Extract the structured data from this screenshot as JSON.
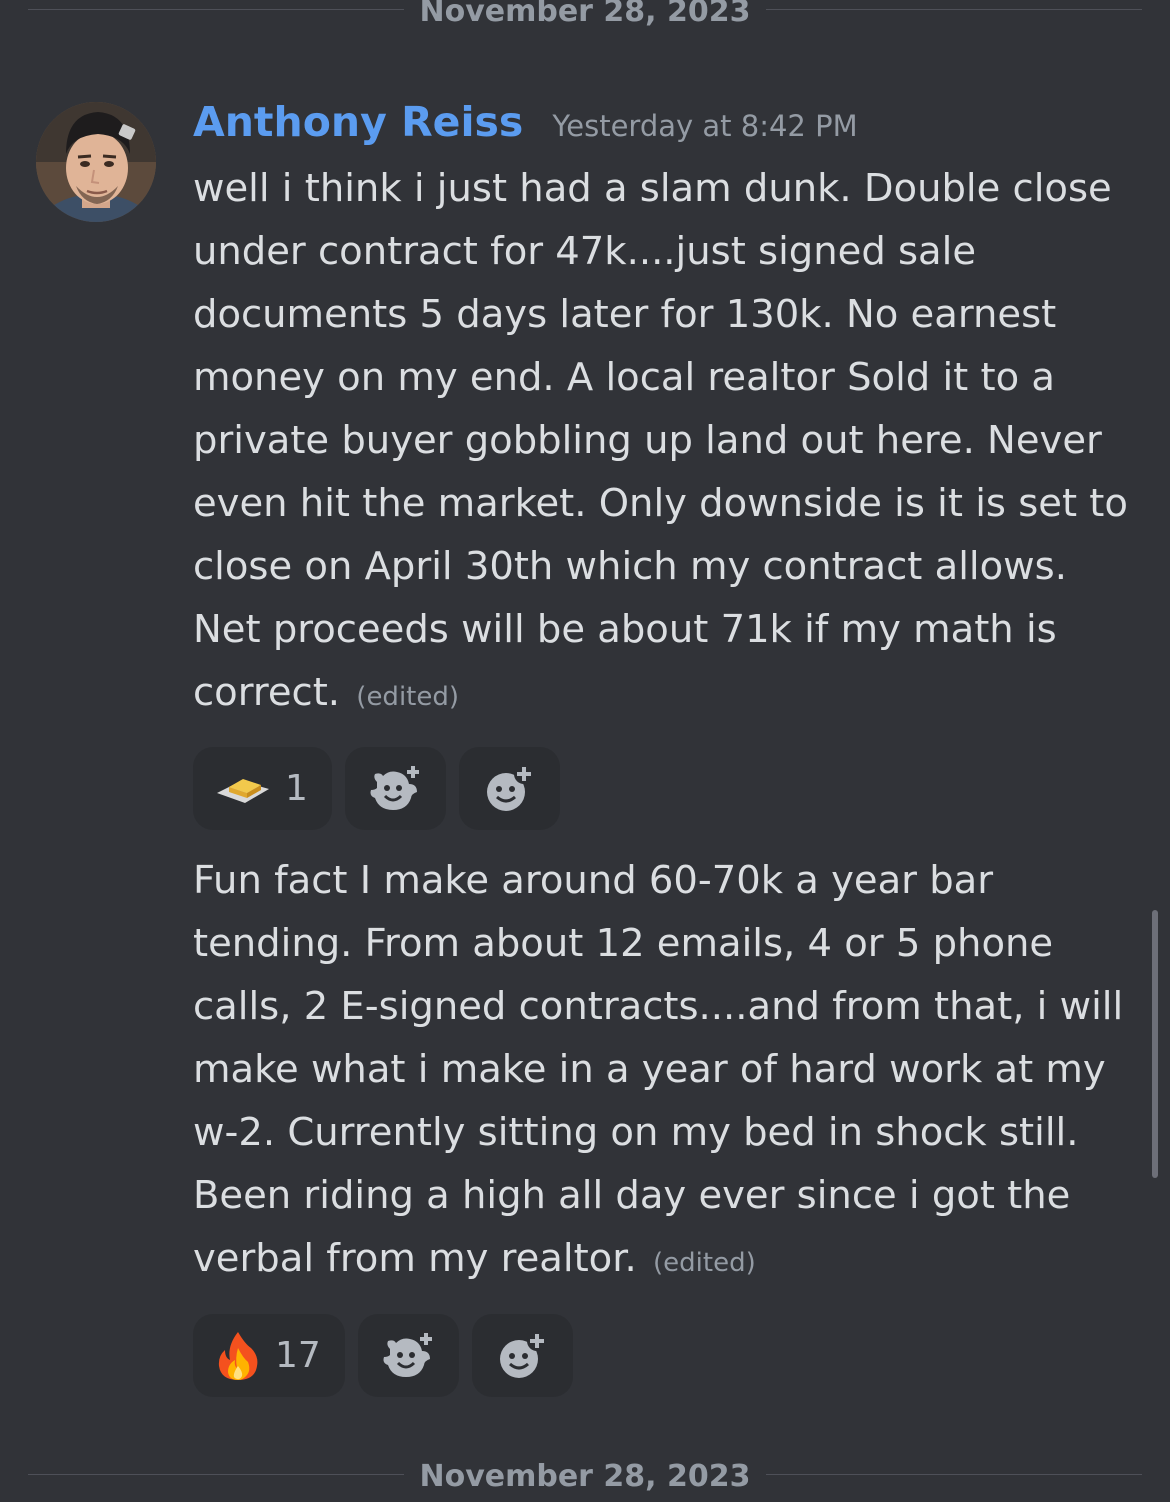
{
  "dividers": {
    "top": "November 28, 2023",
    "bottom": "November 28, 2023"
  },
  "message": {
    "author": "Anthony Reiss",
    "author_color": "#5b9cf0",
    "timestamp": "Yesterday at 8:42 PM",
    "edited_label": "(edited)"
  },
  "messages": [
    {
      "text": "well i think i just had a slam dunk. Double close under contract for 47k....just signed sale documents 5 days later for 130k. No earnest money on my end. A local realtor Sold it to a private buyer gobbling up land out here. Never even hit the market. Only downside is it is set to close on April 30th which my contract allows. Net proceeds will be about 71k if my math is correct.",
      "reaction": {
        "icon": "butter-emoji",
        "count": "1"
      }
    },
    {
      "text": "Fun fact I make around 60-70k a year bar tending. From about 12 emails, 4 or 5 phone calls, 2 E-signed contracts....and from that, i will make what i make in a year of hard work at my w-2. Currently sitting on my bed in shock still. Been riding a high all day ever since i got the verbal from my realtor.",
      "reaction": {
        "icon": "fire-emoji",
        "count": "17"
      }
    }
  ],
  "add_buttons": [
    "add-super-reaction-icon",
    "add-reaction-icon"
  ],
  "colors": {
    "background": "#313338",
    "pill": "#2b2d31",
    "muted": "#949ba4",
    "text": "#dbdee1"
  }
}
